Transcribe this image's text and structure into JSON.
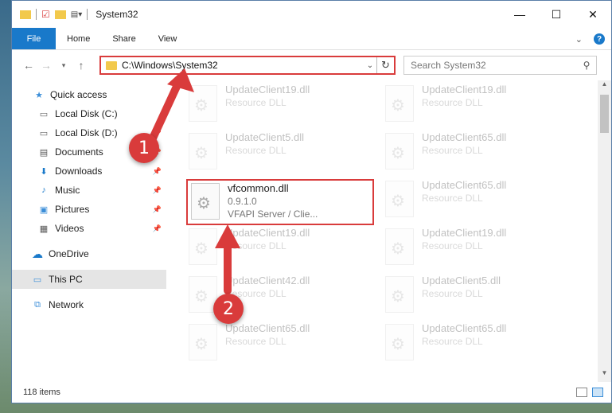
{
  "window": {
    "title": "System32"
  },
  "window_controls": [
    "—",
    "☐",
    "✕"
  ],
  "ribbon": {
    "tabs": [
      "File",
      "Home",
      "Share",
      "View"
    ],
    "expand": "⌄",
    "help": "?"
  },
  "address": {
    "path": "C:\\Windows\\System32"
  },
  "search": {
    "placeholder": "Search System32"
  },
  "sidebar": {
    "items": [
      {
        "label": "Quick access",
        "icon": "star-icon",
        "glyph": "★",
        "pinned": false
      },
      {
        "label": "Local Disk (C:)",
        "icon": "drive-icon",
        "glyph": "▭",
        "pinned": false
      },
      {
        "label": "Local Disk (D:)",
        "icon": "drive-icon",
        "glyph": "▭",
        "pinned": true
      },
      {
        "label": "Documents",
        "icon": "document-icon",
        "glyph": "▤",
        "pinned": true
      },
      {
        "label": "Downloads",
        "icon": "download-icon",
        "glyph": "⬇",
        "pinned": true
      },
      {
        "label": "Music",
        "icon": "music-icon",
        "glyph": "♪",
        "pinned": true
      },
      {
        "label": "Pictures",
        "icon": "pictures-icon",
        "glyph": "▣",
        "pinned": true
      },
      {
        "label": "Videos",
        "icon": "video-icon",
        "glyph": "▦",
        "pinned": true
      },
      {
        "label": "OneDrive",
        "icon": "cloud-icon",
        "glyph": "☁",
        "pinned": false
      },
      {
        "label": "This PC",
        "icon": "computer-icon",
        "glyph": "▭",
        "pinned": false,
        "selected": true
      },
      {
        "label": "Network",
        "icon": "network-icon",
        "glyph": "⧉",
        "pinned": false
      }
    ]
  },
  "files": {
    "left": [
      {
        "name": "UpdateClient19.dll",
        "desc": "Resource DLL"
      },
      {
        "name": "UpdateClient5.dll",
        "desc": "Resource DLL"
      },
      {
        "name": "vfcommon.dll",
        "version": "0.9.1.0",
        "desc": "VFAPI Server / Clie..."
      },
      {
        "name": "UpdateClient19.dll",
        "desc": "Resource DLL"
      },
      {
        "name": "UpdateClient42.dll",
        "desc": "Resource DLL"
      },
      {
        "name": "UpdateClient65.dll",
        "desc": "Resource DLL"
      }
    ],
    "right": [
      {
        "name": "UpdateClient19.dll",
        "desc": "Resource DLL"
      },
      {
        "name": "UpdateClient65.dll",
        "desc": "Resource DLL"
      },
      {
        "name": "UpdateClient65.dll",
        "desc": "Resource DLL"
      },
      {
        "name": "UpdateClient19.dll",
        "desc": "Resource DLL"
      },
      {
        "name": "UpdateClient5.dll",
        "desc": "Resource DLL"
      },
      {
        "name": "UpdateClient65.dll",
        "desc": "Resource DLL"
      }
    ]
  },
  "status": {
    "item_count": "118 items"
  },
  "annotations": {
    "step1": "1",
    "step2": "2",
    "color": "#d93b3b"
  }
}
